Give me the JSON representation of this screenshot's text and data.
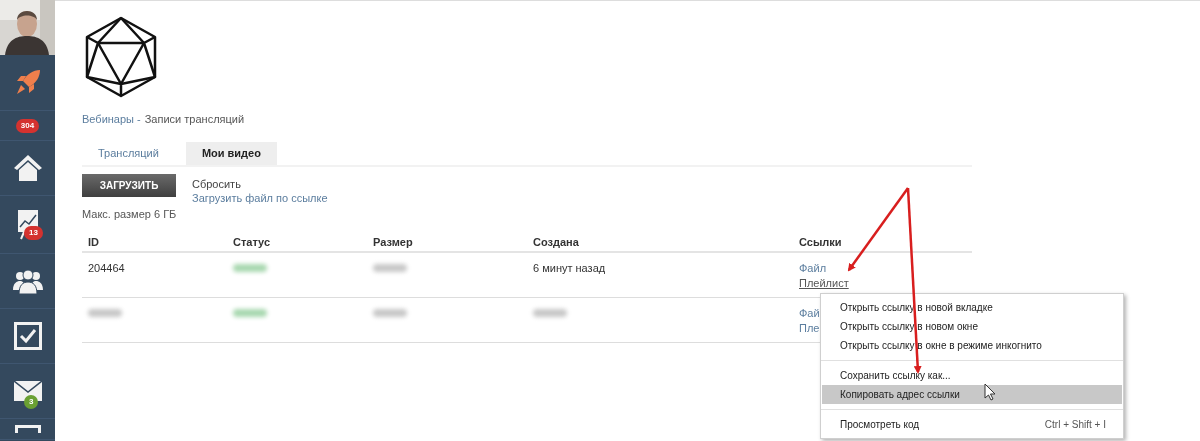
{
  "sidebar": {
    "items": [
      {
        "kind": "avatar"
      },
      {
        "kind": "rocket"
      },
      {
        "kind": "counter",
        "badge": "304",
        "color": "#d4322f"
      },
      {
        "kind": "home"
      },
      {
        "kind": "chart",
        "badge": "13",
        "color": "#d4322f"
      },
      {
        "kind": "people"
      },
      {
        "kind": "tasks"
      },
      {
        "kind": "mail",
        "badge": "3",
        "color": "#6aa033"
      },
      {
        "kind": "partial"
      }
    ]
  },
  "breadcrumb": [
    {
      "text": "Вебинары -",
      "kind": "link"
    },
    {
      "text": "Записи трансляций",
      "kind": "current"
    }
  ],
  "tabs": [
    {
      "label": "Трансляций",
      "selected": false
    },
    {
      "label": "Мои видео",
      "selected": true
    }
  ],
  "upload_button": "ЗАГРУЗИТЬ",
  "reset_link": "Сбросить",
  "upload_by_link": "Загрузить файл по ссылке",
  "max_size": "Макс. размер 6 ГБ",
  "table": {
    "columns": [
      "ID",
      "Статус",
      "Размер",
      "Создана",
      "Ссылки"
    ],
    "rows": [
      {
        "cells": [
          {
            "kind": "text",
            "text": "204464"
          },
          {
            "kind": "greenblur"
          },
          {
            "kind": "blur"
          },
          {
            "kind": "text",
            "text": "6 минут назад"
          },
          {
            "kind": "links",
            "links": [
              {
                "text": "Файл",
                "hovered": false
              },
              {
                "text": "Плейлист",
                "hovered": true
              }
            ]
          }
        ]
      },
      {
        "cells": [
          {
            "kind": "blur"
          },
          {
            "kind": "greenblur"
          },
          {
            "kind": "blur"
          },
          {
            "kind": "blur"
          },
          {
            "kind": "links",
            "links": [
              {
                "text": "Фай",
                "hovered": false
              },
              {
                "text": "Пле",
                "hovered": false
              }
            ]
          }
        ]
      }
    ]
  },
  "context_menu": {
    "groups": [
      [
        {
          "label": "Открыть ссылку в новой вкладке",
          "selected": false
        },
        {
          "label": "Открыть ссылку в новом окне",
          "selected": false
        },
        {
          "label": "Открыть ссылку в окне в режиме инкогнито",
          "selected": false
        }
      ],
      [
        {
          "label": "Сохранить ссылку как...",
          "selected": false
        },
        {
          "label": "Копировать адрес ссылки",
          "selected": true
        }
      ],
      [
        {
          "label": "Просмотреть код",
          "shortcut": "Ctrl + Shift + I",
          "selected": false
        }
      ]
    ]
  }
}
